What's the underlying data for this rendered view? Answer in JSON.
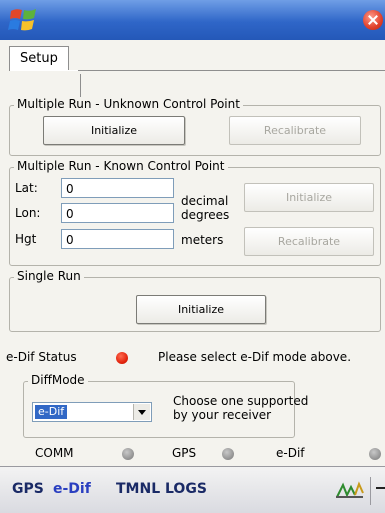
{
  "tabs": [
    {
      "label": "Setup"
    }
  ],
  "unknown_group": {
    "title": "Multiple Run - Unknown Control Point",
    "initialize_label": "Initialize",
    "recalibrate_label": "Recalibrate"
  },
  "known_group": {
    "title": "Multiple Run - Known Control Point",
    "lat_label": "Lat:",
    "lat_value": "0",
    "lon_label": "Lon:",
    "lon_value": "0",
    "hgt_label": "Hgt",
    "hgt_value": "0",
    "unit_decimal": "decimal",
    "unit_degrees": "degrees",
    "unit_meters": "meters",
    "initialize_label": "Initialize",
    "recalibrate_label": "Recalibrate"
  },
  "single_group": {
    "title": "Single Run",
    "initialize_label": "Initialize"
  },
  "edif_status": {
    "label": "e-Dif Status",
    "message": "Please select e-Dif mode above.",
    "indicator_color": "#e0200a"
  },
  "diffmode": {
    "title": "DiffMode",
    "selected": "e-Dif",
    "hint_line1": "Choose one supported",
    "hint_line2": "by your receiver"
  },
  "indicators": [
    {
      "label": "COMM",
      "color": "#909090"
    },
    {
      "label": "GPS",
      "color": "#909090"
    },
    {
      "label": "e-Dif",
      "color": "#909090"
    }
  ],
  "menu": [
    {
      "label": "GPS",
      "color": "#1a2a66"
    },
    {
      "label": "e-Dif",
      "color": "#2a3fc0"
    },
    {
      "label": "TMNL",
      "color": "#1a2a66"
    },
    {
      "label": "LOGS",
      "color": "#1a2a66"
    }
  ],
  "icons": {
    "start": "windows-start-icon",
    "close": "close-icon",
    "keyboard": "input-panel-icon",
    "menu_arrow": "menu-arrow-icon"
  }
}
